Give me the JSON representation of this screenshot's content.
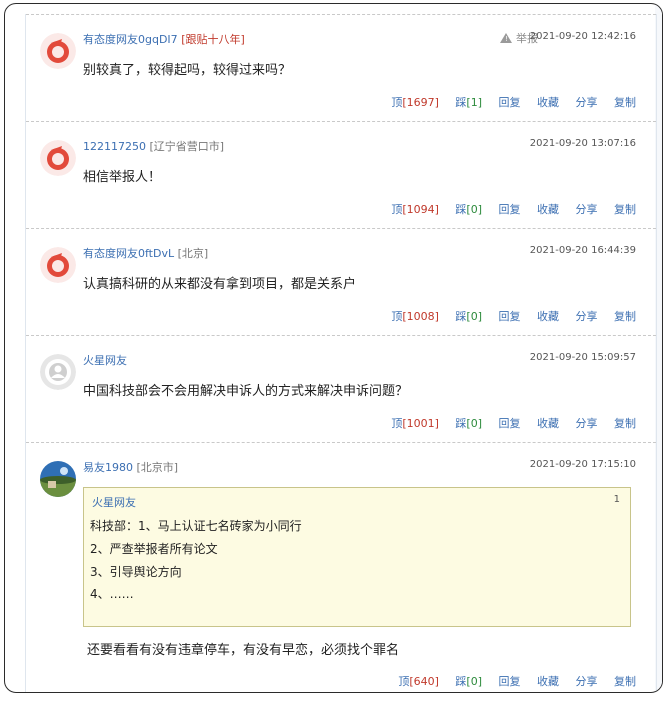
{
  "comments": [
    {
      "user": "有态度网友0gqDI7",
      "tag": "[跟贴十八年]",
      "location": "",
      "report": "举报",
      "time": "2021-09-20 12:42:16",
      "text": "别较真了，较得起吗，较得过来吗？",
      "up": "1697",
      "down": "1"
    },
    {
      "user": "122117250",
      "tag": "",
      "location": "[辽宁省营口市]",
      "time": "2021-09-20 13:07:16",
      "text": "相信举报人！",
      "up": "1094",
      "down": "0"
    },
    {
      "user": "有态度网友0ftDvL",
      "tag": "",
      "location": "[北京]",
      "time": "2021-09-20 16:44:39",
      "text": "认真搞科研的从来都没有拿到项目，都是关系户",
      "up": "1008",
      "down": "0"
    },
    {
      "user": "火星网友",
      "tag": "",
      "location": "",
      "time": "2021-09-20 15:09:57",
      "text": "中国科技部会不会用解决申诉人的方式来解决申诉问题？",
      "up": "1001",
      "down": "0"
    },
    {
      "user": "易友1980",
      "tag": "",
      "location": "[北京市]",
      "time": "2021-09-20 17:15:10",
      "quote": {
        "user": "火星网友",
        "floor": "1",
        "lines": [
          "科技部：1、马上认证七名砖家为小同行",
          "2、严查举报者所有论文",
          "3、引导舆论方向",
          "4、……"
        ]
      },
      "text": "还要看看有没有违章停车，有没有早恋，必须找个罪名",
      "up": "640",
      "down": "0"
    }
  ],
  "actions": {
    "up_label": "顶",
    "down_label": "踩",
    "reply": "回复",
    "favorite": "收藏",
    "share": "分享",
    "copy": "复制"
  }
}
